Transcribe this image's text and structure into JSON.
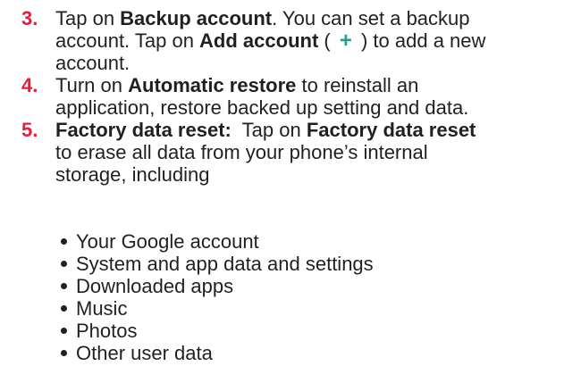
{
  "colors": {
    "step_number": "#e31e3c",
    "plus_icon": "#17a58b",
    "text": "#231f20"
  },
  "steps": [
    {
      "number": "3.",
      "lines": [
        [
          "Tap on ",
          "Backup account",
          ". You can set a backup"
        ],
        [
          "account. Tap on ",
          "Add account",
          " ( ",
          "+",
          " ) to add a new"
        ],
        [
          "account."
        ]
      ]
    },
    {
      "number": "4.",
      "lines": [
        [
          "Turn on ",
          "Automatic restore",
          " to reinstall an"
        ],
        [
          "application, restore backed up setting and data."
        ]
      ]
    },
    {
      "number": "5.",
      "lines": [
        [
          "Factory data reset:",
          "  Tap on ",
          "Factory data reset"
        ],
        [
          "to erase all data from your phone’s internal"
        ],
        [
          "storage, including"
        ]
      ]
    }
  ],
  "bullets": [
    "Your Google account",
    "System and app data and settings",
    "Downloaded apps",
    "Music",
    "Photos",
    "Other user data"
  ]
}
